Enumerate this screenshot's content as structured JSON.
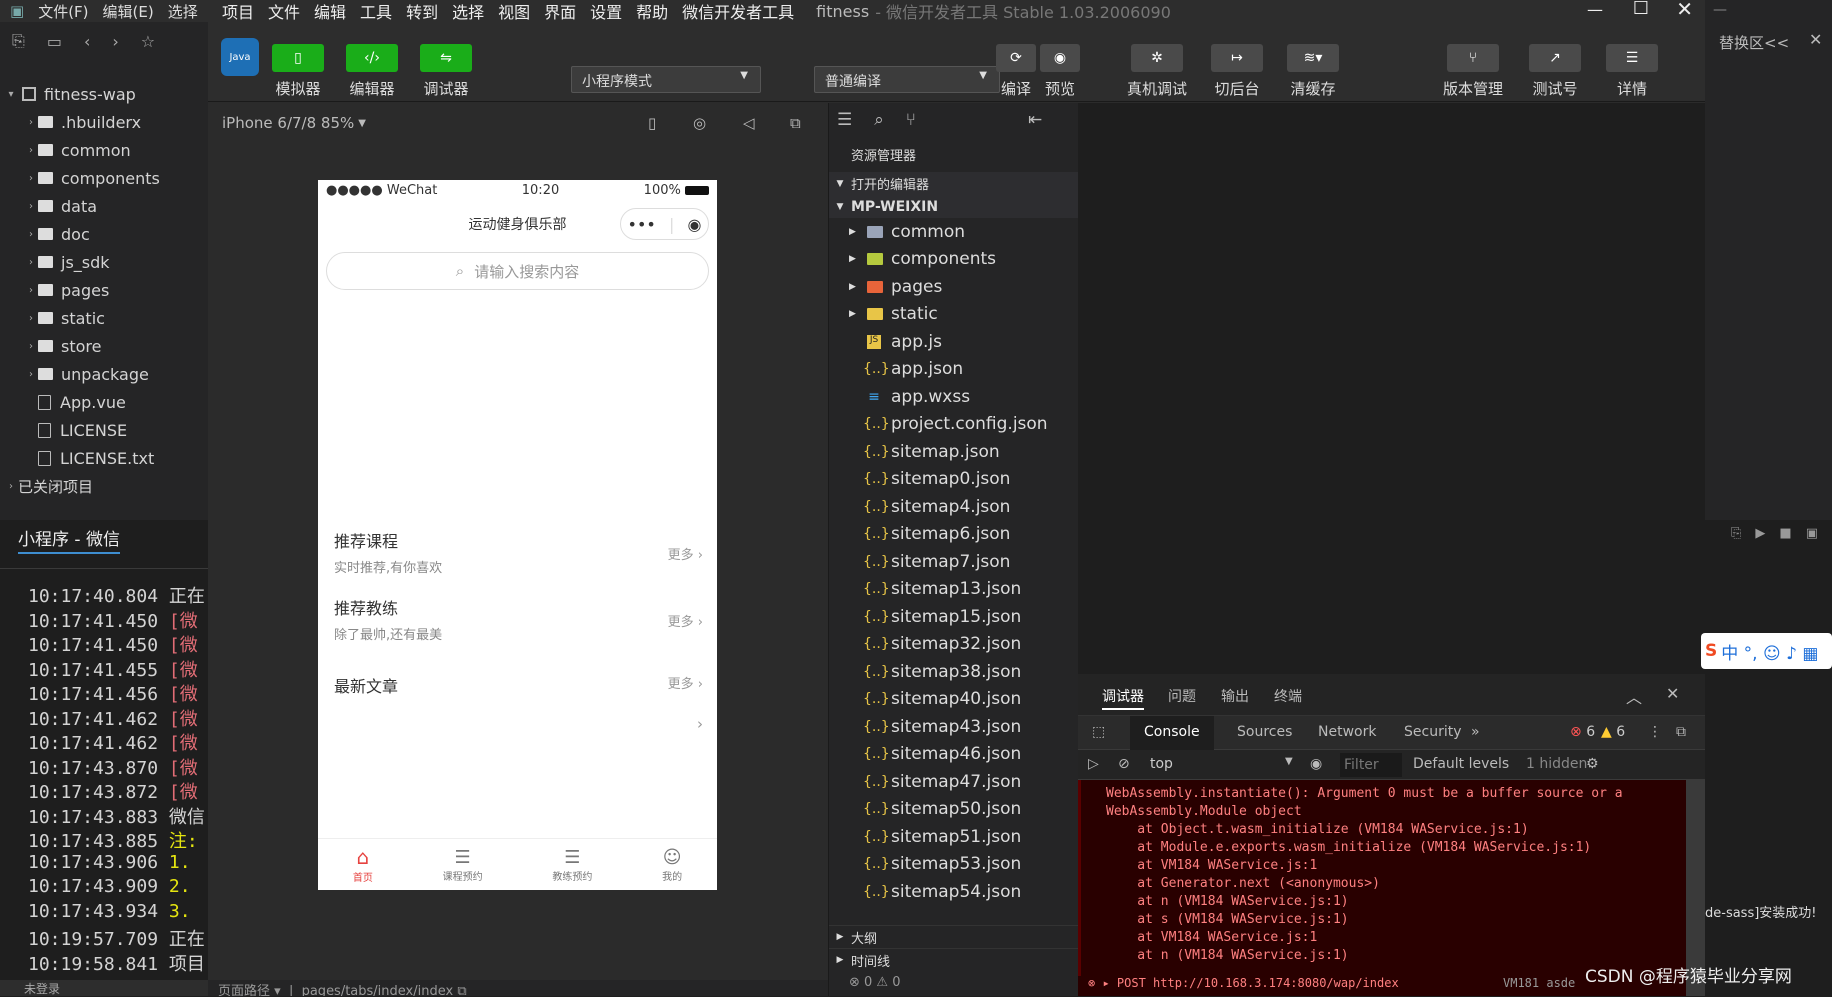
{
  "hbuilder": {
    "menu": [
      "文件(F)",
      "编辑(E)",
      "选择"
    ],
    "project": "fitness-wap",
    "tree": [
      {
        "name": ".hbuilderx",
        "type": "folder"
      },
      {
        "name": "common",
        "type": "folder"
      },
      {
        "name": "components",
        "type": "folder"
      },
      {
        "name": "data",
        "type": "folder"
      },
      {
        "name": "doc",
        "type": "folder"
      },
      {
        "name": "js_sdk",
        "type": "folder"
      },
      {
        "name": "pages",
        "type": "folder"
      },
      {
        "name": "static",
        "type": "folder"
      },
      {
        "name": "store",
        "type": "folder"
      },
      {
        "name": "unpackage",
        "type": "folder"
      },
      {
        "name": "App.vue",
        "type": "file"
      },
      {
        "name": "LICENSE",
        "type": "file"
      },
      {
        "name": "LICENSE.txt",
        "type": "file"
      }
    ],
    "closed_projects": "已关闭项目",
    "console_tab": "小程序 - 微信",
    "log": [
      {
        "time": "10:17:40.804",
        "text": "正在"
      },
      {
        "time": "10:17:41.450",
        "text": "[微"
      },
      {
        "time": "10:17:41.450",
        "text": "[微"
      },
      {
        "time": "10:17:41.455",
        "text": "[微"
      },
      {
        "time": "10:17:41.456",
        "text": "[微"
      },
      {
        "time": "10:17:41.462",
        "text": "[微"
      },
      {
        "time": "10:17:41.462",
        "text": "[微"
      },
      {
        "time": "10:17:43.870",
        "text": "[微"
      },
      {
        "time": "10:17:43.872",
        "text": "[微"
      },
      {
        "time": "10:17:43.883",
        "text": "微信"
      },
      {
        "time": "10:17:43.885",
        "text": "注:"
      },
      {
        "time": "10:17:43.906",
        "text": "1."
      },
      {
        "time": "10:17:43.909",
        "text": "2."
      },
      {
        "time": "10:17:43.934",
        "text": "3."
      },
      {
        "time": "10:19:57.709",
        "text": "正在"
      },
      {
        "time": "10:19:58.841",
        "text": "项目"
      }
    ],
    "bottom_status": "未登录"
  },
  "wx": {
    "menu": [
      "项目",
      "文件",
      "编辑",
      "工具",
      "转到",
      "选择",
      "视图",
      "界面",
      "设置",
      "帮助",
      "微信开发者工具"
    ],
    "title": "fitness",
    "title_suffix": "- 微信开发者工具 Stable 1.03.2006090",
    "toolbar": {
      "simulator": "模拟器",
      "editor": "编辑器",
      "debugger": "调试器",
      "mode": "小程序模式",
      "compile_mode": "普通编译",
      "compile": "编译",
      "preview": "预览",
      "real_debug": "真机调试",
      "background": "切后台",
      "clear_cache": "清缓存",
      "version": "版本管理",
      "test_account": "测试号",
      "details": "详情"
    },
    "device": "iPhone 6/7/8 85%",
    "phone": {
      "carrier": "●●●●● WeChat",
      "time": "10:20",
      "battery": "100%",
      "nav_title": "运动健身俱乐部",
      "search_placeholder": "请输入搜索内容",
      "sections": [
        {
          "title": "推荐课程",
          "sub": "实时推荐,有你喜欢",
          "more": "更多"
        },
        {
          "title": "推荐教练",
          "sub": "除了最帅,还有最美",
          "more": "更多"
        },
        {
          "title": "最新文章",
          "sub": "",
          "more": "更多"
        }
      ],
      "tabs": [
        "首页",
        "课程预约",
        "教练预约",
        "我的"
      ]
    },
    "explorer": {
      "title": "资源管理器",
      "open_editors": "打开的编辑器",
      "root": "MP-WEIXIN",
      "folders": [
        "common",
        "components",
        "pages",
        "static"
      ],
      "files": [
        "app.js",
        "app.json",
        "app.wxss",
        "project.config.json",
        "sitemap.json",
        "sitemap0.json",
        "sitemap4.json",
        "sitemap6.json",
        "sitemap7.json",
        "sitemap13.json",
        "sitemap15.json",
        "sitemap32.json",
        "sitemap38.json",
        "sitemap40.json",
        "sitemap43.json",
        "sitemap46.json",
        "sitemap47.json",
        "sitemap50.json",
        "sitemap51.json",
        "sitemap53.json",
        "sitemap54.json"
      ],
      "outline": "大纲",
      "timeline": "时间线"
    },
    "debug": {
      "tabs": [
        "调试器",
        "问题",
        "输出",
        "终端"
      ],
      "devtabs": [
        "Console",
        "Sources",
        "Network",
        "Security"
      ],
      "errors": "6",
      "warnings": "6",
      "context": "top",
      "filter_placeholder": "Filter",
      "levels": "Default levels",
      "hidden": "1 hidden",
      "error_lines": [
        "WebAssembly.instantiate(): Argument 0 must be a buffer source or a",
        "WebAssembly.Module object",
        "    at Object.t.wasm_initialize (VM184 WAService.js:1)",
        "    at Module.e.exports.wasm_initialize (VM184 WAService.js:1)",
        "    at VM184 WAService.js:1",
        "    at Generator.next (<anonymous>)",
        "    at n (VM184 WAService.js:1)",
        "    at s (VM184 WAService.js:1)",
        "    at VM184 WAService.js:1",
        "    at n (VM184 WAService.js:1)"
      ],
      "post_line": "▸ POST http://10.168.3.174:8080/wap/index",
      "post_src": "VM181 asde"
    },
    "status": {
      "path_label": "页面路径",
      "path": "pages/tabs/index/index",
      "errors": "⊗ 0 ⚠ 0"
    }
  },
  "right": {
    "replace": "替换区<<",
    "sass_msg": "de-sass]安装成功!",
    "watermark": "CSDN @程序猿毕业分享网"
  },
  "colors": {
    "green": "#1aad19",
    "error_bg": "#290000",
    "accent_red": "#e64340"
  }
}
